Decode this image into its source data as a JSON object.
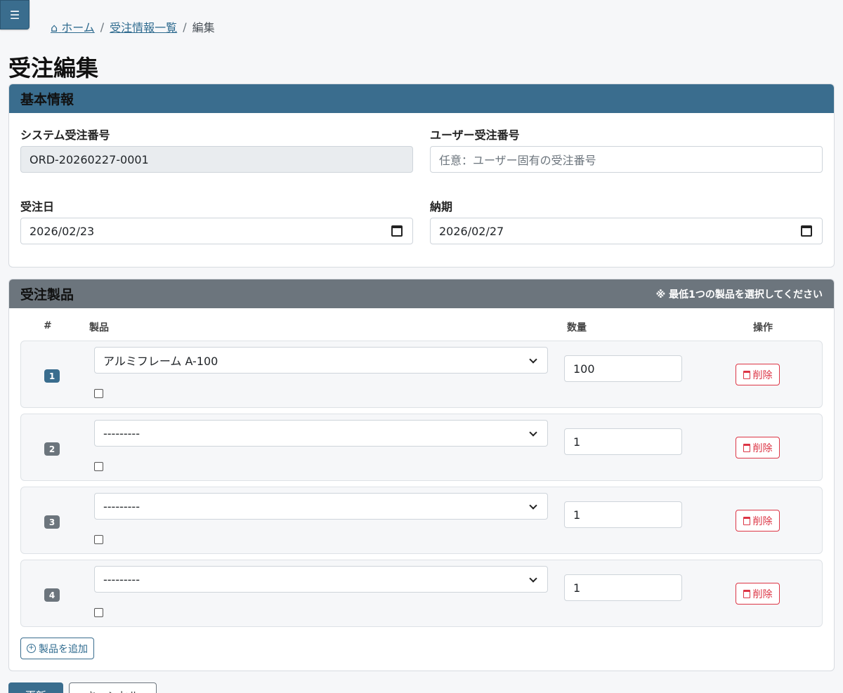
{
  "nav": {
    "menu_icon": "☰"
  },
  "breadcrumb": {
    "home": "ホーム",
    "list": "受注情報一覧",
    "current": "編集",
    "separator": "/"
  },
  "page_title": "受注編集",
  "basic_info": {
    "header": "基本情報",
    "system_order_no": {
      "label": "システム受注番号",
      "value": "ORD-20260227-0001"
    },
    "user_order_no": {
      "label": "ユーザー受注番号",
      "placeholder": "任意：ユーザー固有の受注番号"
    },
    "order_date": {
      "label": "受注日",
      "value": "2026/02/23"
    },
    "delivery_date": {
      "label": "納期",
      "value": "2026/02/27"
    }
  },
  "products": {
    "header": "受注製品",
    "note": "※ 最低1つの製品を選択してください",
    "columns": {
      "index": "#",
      "product": "製品",
      "quantity": "数量",
      "action": "操作"
    },
    "rows": [
      {
        "index": "1",
        "product": "アルミフレーム A-100",
        "quantity": "100",
        "delete": "削除"
      },
      {
        "index": "2",
        "product": "---------",
        "quantity": "1",
        "delete": "削除"
      },
      {
        "index": "3",
        "product": "---------",
        "quantity": "1",
        "delete": "削除"
      },
      {
        "index": "4",
        "product": "---------",
        "quantity": "1",
        "delete": "削除"
      }
    ],
    "add_button": "製品を追加"
  },
  "footer": {
    "save": "更新",
    "back": "キャンセル"
  },
  "colors": {
    "primary": "#3a6d8e",
    "secondary": "#6c757d",
    "danger": "#dc3545"
  }
}
